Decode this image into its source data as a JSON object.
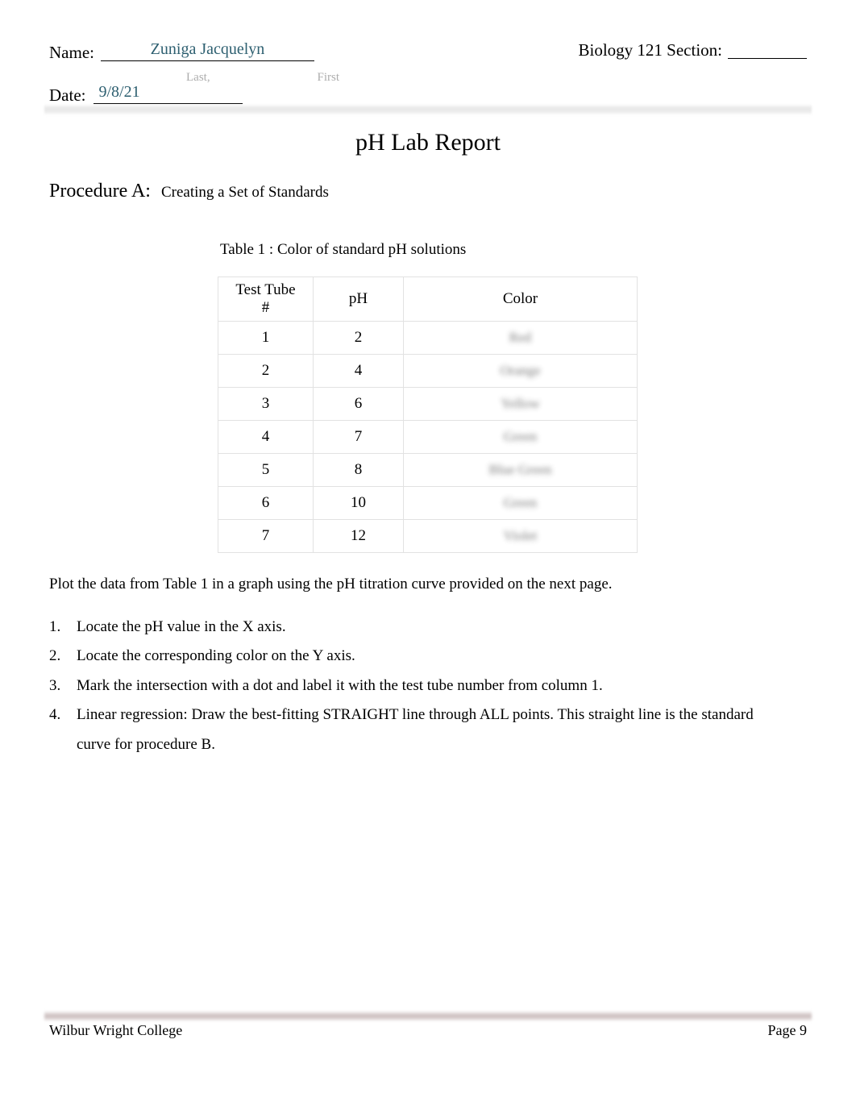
{
  "header": {
    "name_label": "Name:",
    "name_value": "Zuniga Jacquelyn",
    "sub_last": "Last,",
    "sub_first": "First",
    "date_label": "Date:",
    "date_value": "9/8/21",
    "section_label": "Biology 121 Section:",
    "section_value": ""
  },
  "title": "pH Lab Report",
  "procedure": {
    "label": "Procedure A:",
    "text": "Creating a Set of Standards"
  },
  "table": {
    "caption": "Table 1 : Color of standard pH solutions",
    "columns": [
      "Test Tube\n#",
      "pH",
      "Color"
    ],
    "header_tube_line1": "Test Tube",
    "header_tube_line2": "#",
    "header_ph": "pH",
    "header_color": "Color",
    "rows": [
      {
        "tube": "1",
        "ph": "2",
        "color": "Red"
      },
      {
        "tube": "2",
        "ph": "4",
        "color": "Orange"
      },
      {
        "tube": "3",
        "ph": "6",
        "color": "Yellow"
      },
      {
        "tube": "4",
        "ph": "7",
        "color": "Green"
      },
      {
        "tube": "5",
        "ph": "8",
        "color": "Blue Green"
      },
      {
        "tube": "6",
        "ph": "10",
        "color": "Green"
      },
      {
        "tube": "7",
        "ph": "12",
        "color": "Violet"
      }
    ]
  },
  "body": {
    "plot_instruction": "Plot the data from Table 1 in a graph using the pH titration curve provided on the next page.",
    "steps": [
      {
        "num": "1.",
        "text": "Locate the pH value in the X axis."
      },
      {
        "num": "2.",
        "text": "Locate the corresponding color on the Y axis."
      },
      {
        "num": "3.",
        "text": "Mark the intersection with a dot and label it with the test tube number from column 1."
      },
      {
        "num": "4.",
        "text": "Linear regression: Draw the best-fitting STRAIGHT line through ALL points. This straight line is the standard curve for procedure B."
      }
    ]
  },
  "footer": {
    "institution": "Wilbur Wright College",
    "page": "Page 9"
  },
  "colors": {
    "filled_field_text": "#2d5f70",
    "caption_gray": "#adadad",
    "header_band": "#e8e8e8",
    "footer_band": "#cdc0c0",
    "table_border": "#e2e2e2"
  }
}
